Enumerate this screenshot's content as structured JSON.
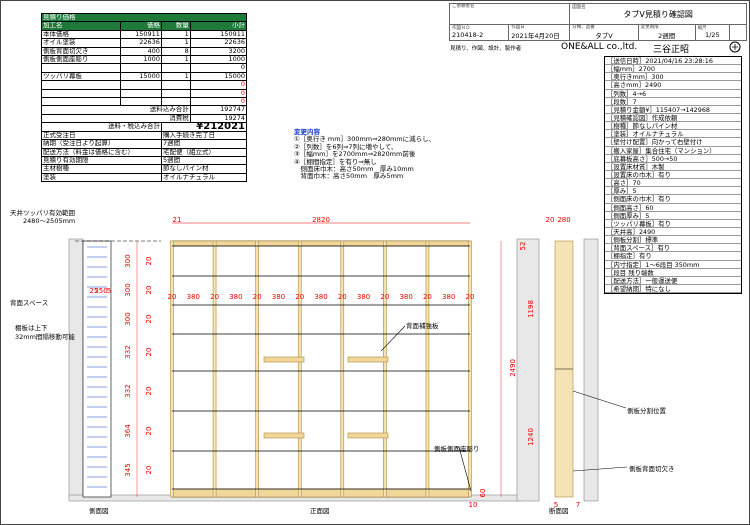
{
  "estimate": {
    "title": "見積り価格",
    "headers": [
      "加工名",
      "価格",
      "数量",
      "小計"
    ],
    "rows": [
      [
        "本体価格",
        "150911",
        "1",
        "150911"
      ],
      [
        "オイル塗装",
        "22636",
        "1",
        "22636"
      ],
      [
        "側板背面切欠き",
        "400",
        "8",
        "3200"
      ],
      [
        "側板側面座彫り",
        "1000",
        "1",
        "1000"
      ],
      [
        "",
        "",
        "",
        "0"
      ],
      [
        "ツッパリ幕板",
        "15000",
        "1",
        "15000"
      ],
      [
        "",
        "",
        "",
        "0"
      ],
      [
        "",
        "",
        "",
        "0"
      ],
      [
        "",
        "",
        "",
        "0"
      ]
    ],
    "shipping_label": "送料込み合計",
    "shipping_value": "192747",
    "tax_label": "消費税",
    "tax_value": "19274",
    "total_label": "送料・税込み合計",
    "total_value": "¥212021",
    "info": [
      [
        "正式受注日",
        "購入手続き完了日"
      ],
      [
        "納期（受注日より起算）",
        "7週間"
      ],
      [
        "配送方法（料金は価格に含む）",
        "宅配便（組立式）"
      ],
      [
        "見積り有効期限",
        "5週間"
      ],
      [
        "主材樹種",
        "節なしパイン材"
      ],
      [
        "塗装",
        "オイルナチュラル"
      ]
    ]
  },
  "titleblock": {
    "designer_label": "ご依頼者名",
    "drawing_label": "図面名",
    "drawing_name": "タブV見積り確認図",
    "no_label": "作図ＮＯ",
    "no": "210418-2",
    "date_label": "作図日",
    "date": "2021年4月20日",
    "class_label": "分類、品番",
    "class_value": "タブV",
    "change_label": "変更期限",
    "change_value": "2週間",
    "scale_label": "縮尺",
    "scale_value": "1/25",
    "role": "見積り、作図、設計、製作者",
    "company": "ONE&ALL co.,ltd.",
    "person": "三谷正昭"
  },
  "spec": [
    "［送信日時］2021/04/16 23:28:16",
    "［幅mm］2700",
    "［奥行きmm］300",
    "［高さmm］2490",
    "［列数］4→6",
    "［段数］7",
    "［見積り金額¥］115407→142968",
    "［見積確認図］作成依頼",
    "［樹種］節なしパイン材",
    "［塗装］オイルナチュラル",
    "［壁付け配置］向かって右壁付け",
    "［搬入家屋］集合住宅（マンション）",
    "［底幕板高さ］500→50",
    "［設置床材質］木製",
    "［設置床の巾木］有り",
    "［高さ］70",
    "［厚み］5",
    "［側面床の巾木］有り",
    "［側面高さ］60",
    "［側面厚み］5",
    "［ツッパリ幕板］有り",
    "［天井高］2490",
    "［側板分割］標準",
    "［背面スペース］有り",
    "［棚指定］有り",
    "［内寸指定］1～6段目 350mm",
    "［段目 残り端数",
    "［配送方法］一般運送便",
    "［希望納期］特になし"
  ],
  "changes": {
    "title": "変更内容",
    "items": [
      "①［奥行き mm］300mm⇒280mmに減らし、",
      "②［列数］を6列⇒7列に増やして、",
      "③［幅mm］を2700mm⇒2820mm前後",
      "④［棚間指定］を有り⇒無し",
      "　側面床巾木：高さ50mm　厚み10mm",
      "　背面巾木：高さ50mm　厚み5mm"
    ]
  },
  "drawing": {
    "ceiling_label": "天井ツッパリ有効範囲",
    "ceiling_range": "2480～2505mm",
    "back_space_label": "背面スペース",
    "shelf_note_1": "棚板は上下",
    "shelf_note_2": "32mm間隔移動可能",
    "side_view_label": "側面図",
    "front_view_label": "正面図",
    "section_view_label": "断面図",
    "rear_reinforce_label": "背面補強板",
    "side_recess_label": "側板側面座彫り",
    "side_split_label": "側板分割位置",
    "rear_notch_label": "側板背面切欠き",
    "total_width": "2820",
    "gap_21": "21",
    "col_width": "380",
    "board_20": "20",
    "side_dims": [
      "25",
      "250",
      "5"
    ],
    "row_dims": [
      "300",
      "300",
      "300",
      "332",
      "332",
      "364",
      "345"
    ],
    "height_total": "2490",
    "upper_split": "1198",
    "lower_split": "1240",
    "depth_20": "20",
    "depth_280": "280",
    "bottom_60": "60",
    "bottom_10": "10",
    "bottom_7": "7",
    "bottom_5": "5",
    "top_52": "52"
  }
}
